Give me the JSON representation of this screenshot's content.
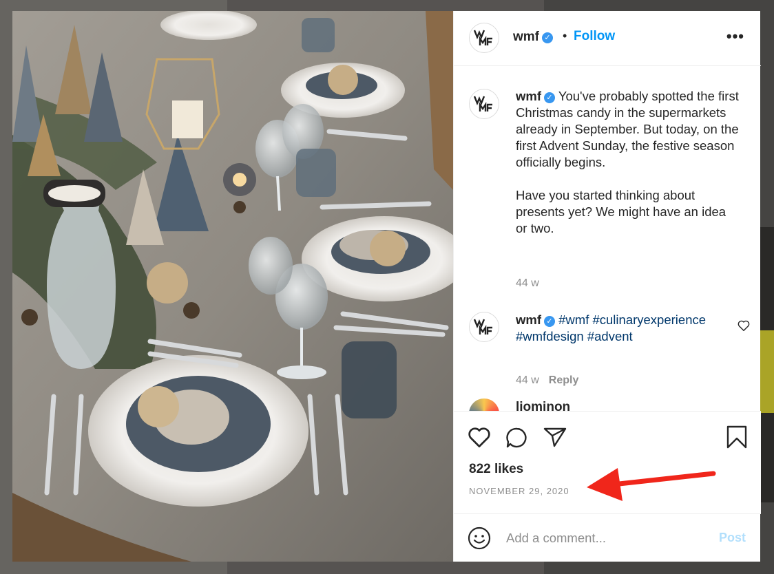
{
  "post": {
    "username": "wmf",
    "verified_mark": "✓",
    "separator": "•",
    "follow_label": "Follow",
    "more_label": "•••",
    "avatar_logo": "wmf-logo"
  },
  "comments": [
    {
      "username": "wmf",
      "text": "You've probably spotted the first Christmas candy in the supermarkets already in September. But today, on the first Advent Sunday, the festive season officially begins.\n\nHave you started thinking about presents yet? We might have an idea or two.",
      "age": "44 w"
    },
    {
      "username": "wmf",
      "hashtags": [
        "#wmf",
        "#culinaryexperience",
        "#wmfdesign",
        "#advent"
      ],
      "age": "44 w",
      "reply_label": "Reply"
    }
  ],
  "partial_comment": {
    "username": "liominon"
  },
  "actions": {
    "icons": [
      "heart-icon",
      "comment-icon",
      "share-icon",
      "bookmark-icon"
    ],
    "likes": "822 likes",
    "date": "NOVEMBER 29, 2020"
  },
  "add_comment": {
    "placeholder": "Add a comment...",
    "post_label": "Post",
    "emoji_icon": "emoji-icon"
  },
  "colors": {
    "link": "#0095f6",
    "verified": "#3897f0",
    "hashtag": "#00376b",
    "muted": "#8e8e8e",
    "post_disabled": "#b2dffc",
    "annotation_arrow": "#f0261b"
  }
}
